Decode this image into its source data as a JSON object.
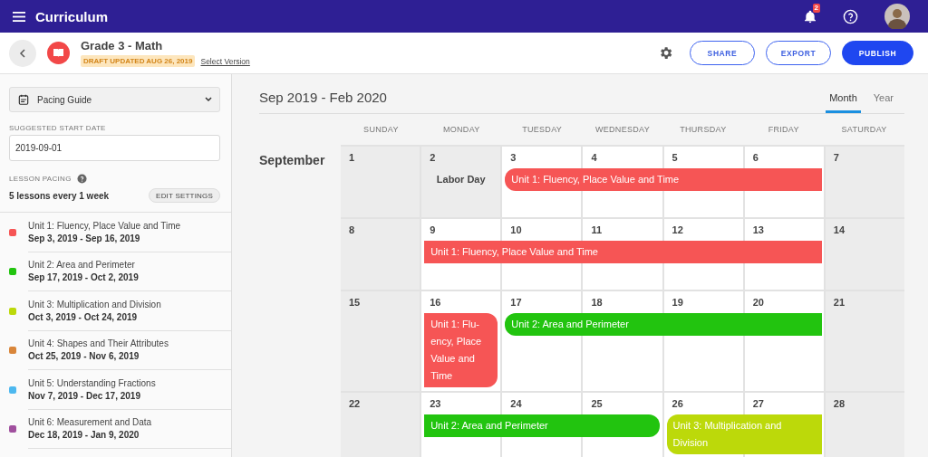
{
  "app_bar": {
    "title": "Curriculum",
    "notification_count": "2"
  },
  "header": {
    "title": "Grade 3 - Math",
    "status": "DRAFT UPDATED AUG 26, 2019",
    "version_link": "Select Version",
    "buttons": [
      {
        "label": "SHARE",
        "kind": "outline"
      },
      {
        "label": "EXPORT",
        "kind": "outline"
      },
      {
        "label": "PUBLISH",
        "kind": "primary"
      }
    ]
  },
  "sidebar": {
    "view_select": "Pacing Guide",
    "start_date": {
      "label": "SUGGESTED START DATE",
      "value": "2019-09-01"
    },
    "pacing": {
      "label": "LESSON PACING",
      "summary": "5 lessons every 1 week",
      "button": "EDIT SETTINGS"
    },
    "units": [
      {
        "name": "Unit 1: Fluency, Place Value and Time",
        "dates": "Sep 3, 2019 - Sep 16, 2019",
        "color": "#f65555"
      },
      {
        "name": "Unit 2: Area and Perimeter",
        "dates": "Sep 17, 2019 - Oct 2, 2019",
        "color": "#22c40f"
      },
      {
        "name": "Unit 3: Multiplication and Division",
        "dates": "Oct 3, 2019 - Oct 24, 2019",
        "color": "#bcd90a"
      },
      {
        "name": "Unit 4: Shapes and Their Attributes",
        "dates": "Oct 25, 2019 - Nov 6, 2019",
        "color": "#d9863a"
      },
      {
        "name": "Unit 5: Understanding Fractions",
        "dates": "Nov 7, 2019 - Dec 17, 2019",
        "color": "#4db8ef"
      },
      {
        "name": "Unit 6: Measurement and Data",
        "dates": "Dec 18, 2019 - Jan 9, 2020",
        "color": "#a0509e"
      }
    ]
  },
  "calendar": {
    "range": "Sep 2019 - Feb 2020",
    "views": [
      {
        "label": "Month",
        "selected": true
      },
      {
        "label": "Year",
        "selected": false
      }
    ],
    "weekdays": [
      "SUNDAY",
      "MONDAY",
      "TUESDAY",
      "WEDNESDAY",
      "THURSDAY",
      "FRIDAY",
      "SATURDAY"
    ],
    "weeks": [
      {
        "month": "September",
        "slots": [
          {
            "kind": "plain",
            "days": [
              {
                "number": "1",
                "off": true
              }
            ]
          },
          {
            "kind": "plain",
            "days": [
              {
                "number": "2",
                "off": true,
                "note": "Labor Day"
              }
            ]
          },
          {
            "kind": "event",
            "label": "Unit 1: Fluency, Place Value and Time",
            "color": "#f65555",
            "starts": true,
            "ends": false,
            "days": [
              {
                "number": "3",
                "off": false
              },
              {
                "number": "4",
                "off": false
              },
              {
                "number": "5",
                "off": false
              },
              {
                "number": "6",
                "off": false
              }
            ]
          },
          {
            "kind": "plain",
            "days": [
              {
                "number": "7",
                "off": true
              }
            ]
          }
        ]
      },
      {
        "slots": [
          {
            "kind": "plain",
            "days": [
              {
                "number": "8",
                "off": true
              }
            ]
          },
          {
            "kind": "event",
            "label": "Unit 1: Fluency, Place Value and Time",
            "color": "#f65555",
            "starts": false,
            "ends": false,
            "days": [
              {
                "number": "9",
                "off": false
              },
              {
                "number": "10",
                "off": false
              },
              {
                "number": "11",
                "off": false
              },
              {
                "number": "12",
                "off": false
              },
              {
                "number": "13",
                "off": false
              }
            ]
          },
          {
            "kind": "plain",
            "days": [
              {
                "number": "14",
                "off": true
              }
            ]
          }
        ]
      },
      {
        "slots": [
          {
            "kind": "plain",
            "days": [
              {
                "number": "15",
                "off": true
              }
            ]
          },
          {
            "kind": "event",
            "label": "Unit 1: Flu-ency, Place Value and Time",
            "color": "#f65555",
            "starts": false,
            "ends": true,
            "days": [
              {
                "number": "16",
                "off": false
              }
            ]
          },
          {
            "kind": "event",
            "label": "Unit 2: Area and Perimeter",
            "color": "#22c40f",
            "starts": true,
            "ends": false,
            "days": [
              {
                "number": "17",
                "off": false
              },
              {
                "number": "18",
                "off": false
              },
              {
                "number": "19",
                "off": false
              },
              {
                "number": "20",
                "off": false
              }
            ]
          },
          {
            "kind": "plain",
            "days": [
              {
                "number": "21",
                "off": true
              }
            ]
          }
        ]
      },
      {
        "slots": [
          {
            "kind": "plain",
            "days": [
              {
                "number": "22",
                "off": true
              }
            ]
          },
          {
            "kind": "event",
            "label": "Unit 2: Area and Perimeter",
            "color": "#22c40f",
            "starts": false,
            "ends": true,
            "days": [
              {
                "number": "23",
                "off": false
              },
              {
                "number": "24",
                "off": false
              },
              {
                "number": "25",
                "off": false
              }
            ]
          },
          {
            "kind": "event",
            "label": "Unit 3: Multiplication and Division",
            "color": "#bcd90a",
            "starts": true,
            "ends": false,
            "days": [
              {
                "number": "26",
                "off": false
              },
              {
                "number": "27",
                "off": false
              }
            ]
          },
          {
            "kind": "plain",
            "days": [
              {
                "number": "28",
                "off": true
              }
            ]
          }
        ]
      }
    ]
  }
}
